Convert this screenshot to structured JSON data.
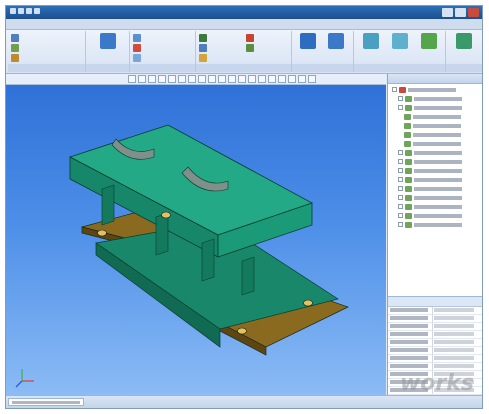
{
  "window": {
    "title": ""
  },
  "menubar": {
    "items": [
      "",
      "",
      "",
      "",
      "",
      "",
      "",
      "",
      ""
    ]
  },
  "ribbon": {
    "groups": [
      {
        "label": "",
        "buttons": [
          "",
          "",
          ""
        ]
      },
      {
        "label": "",
        "buttons": [
          "",
          "",
          ""
        ]
      },
      {
        "label": "",
        "buttons": [
          "",
          "",
          ""
        ]
      },
      {
        "label": "",
        "buttons": [
          "",
          "",
          "",
          "",
          ""
        ]
      },
      {
        "label": "",
        "buttons": [
          "",
          ""
        ]
      },
      {
        "label": "",
        "buttons": [
          "",
          "",
          ""
        ]
      },
      {
        "label": "",
        "buttons": [
          ""
        ]
      }
    ]
  },
  "side_panel": {
    "header": "",
    "tree": [
      {
        "level": 0,
        "label": ""
      },
      {
        "level": 1,
        "label": ""
      },
      {
        "level": 1,
        "label": ""
      },
      {
        "level": 2,
        "label": ""
      },
      {
        "level": 2,
        "label": ""
      },
      {
        "level": 2,
        "label": ""
      },
      {
        "level": 2,
        "label": ""
      },
      {
        "level": 1,
        "label": ""
      },
      {
        "level": 1,
        "label": ""
      },
      {
        "level": 1,
        "label": ""
      },
      {
        "level": 1,
        "label": ""
      },
      {
        "level": 1,
        "label": ""
      },
      {
        "level": 1,
        "label": ""
      },
      {
        "level": 1,
        "label": ""
      },
      {
        "level": 1,
        "label": ""
      },
      {
        "level": 1,
        "label": ""
      }
    ],
    "properties": {
      "col_name": "",
      "col_value": ""
    }
  },
  "status": {
    "doc_tab": ""
  },
  "colors": {
    "model_body": "#1f9e78",
    "model_pads": "#8a6a1f",
    "viewport_top": "#2f71d7",
    "viewport_bottom": "#8dbcf5"
  },
  "watermark": "works"
}
